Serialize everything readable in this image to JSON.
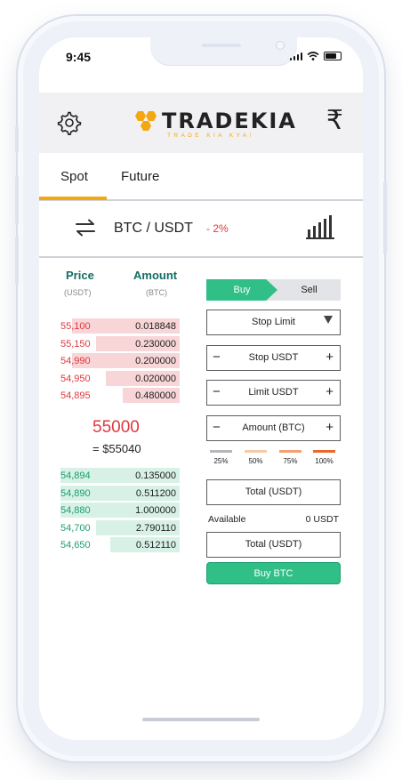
{
  "status": {
    "time": "9:45"
  },
  "header": {
    "logo_text": "TRADEKIA",
    "tagline": "TRADE KIA KYA!",
    "currency_symbol": "₹"
  },
  "tabs": [
    {
      "label": "Spot",
      "active": true
    },
    {
      "label": "Future",
      "active": false
    }
  ],
  "pair": {
    "name": "BTC / USDT",
    "change": "- 2%"
  },
  "orderbook": {
    "price_header": "Price",
    "amount_header": "Amount",
    "price_unit": "(USDT)",
    "amount_unit": "(BTC)",
    "asks": [
      {
        "price": "55,100",
        "amount": "0.018848",
        "depth": 0.9
      },
      {
        "price": "55,150",
        "amount": "0.230000",
        "depth": 0.7
      },
      {
        "price": "54,990",
        "amount": "0.200000",
        "depth": 0.9
      },
      {
        "price": "54,950",
        "amount": "0.020000",
        "depth": 0.62
      },
      {
        "price": "54,895",
        "amount": "0.480000",
        "depth": 0.48
      }
    ],
    "last_price": "55000",
    "last_price_usd": "= $55040",
    "bids": [
      {
        "price": "54,894",
        "amount": "0.135000",
        "depth": 1.0
      },
      {
        "price": "54,890",
        "amount": "0.511200",
        "depth": 1.0
      },
      {
        "price": "54,880",
        "amount": "1.000000",
        "depth": 1.0
      },
      {
        "price": "54,700",
        "amount": "2.790110",
        "depth": 0.7
      },
      {
        "price": "54,650",
        "amount": "0.512110",
        "depth": 0.58
      }
    ]
  },
  "form": {
    "buy_label": "Buy",
    "sell_label": "Sell",
    "order_type": "Stop Limit",
    "stop_label": "Stop USDT",
    "limit_label": "Limit USDT",
    "amount_label": "Amount (BTC)",
    "minus": "−",
    "plus": "+",
    "percents": [
      {
        "label": "25%",
        "color": "#b5b7bb"
      },
      {
        "label": "50%",
        "color": "#f6c9a8"
      },
      {
        "label": "75%",
        "color": "#f2a06e"
      },
      {
        "label": "100%",
        "color": "#e86a2a"
      }
    ],
    "total_label": "Total (USDT)",
    "available_label": "Available",
    "available_value": "0 USDT",
    "total_label_2": "Total (USDT)",
    "submit_label": "Buy BTC"
  },
  "colors": {
    "accent": "#f3a712",
    "buy": "#2fbf87",
    "sell": "#e0383e"
  }
}
